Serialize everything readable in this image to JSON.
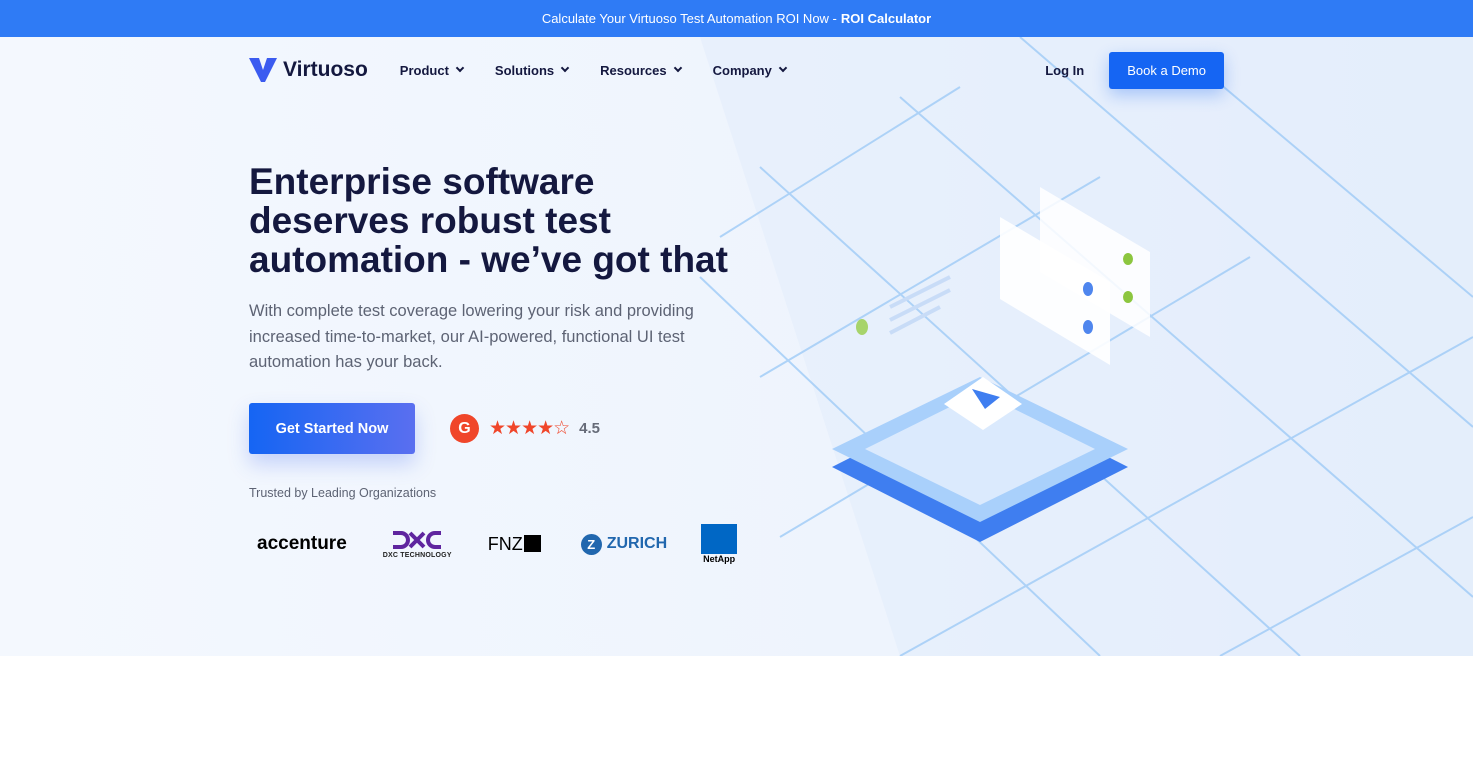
{
  "banner": {
    "text": "Calculate Your Virtuoso Test Automation ROI Now -",
    "link": "ROI Calculator"
  },
  "nav": {
    "logo": "Virtuoso",
    "items": [
      {
        "label": "Product"
      },
      {
        "label": "Solutions"
      },
      {
        "label": "Resources"
      },
      {
        "label": "Company"
      }
    ],
    "login": "Log In",
    "demo": "Book a Demo"
  },
  "hero": {
    "title": "Enterprise software deserves robust test automation - we’ve got that",
    "subtitle": "With complete test coverage lowering your risk and providing increased time-to-market, our AI-powered, functional UI test automation has your back.",
    "cta": "Get Started Now",
    "rating": {
      "logo": "G2",
      "stars": "★★★★☆",
      "value": "4.5",
      "fraction": 0.9
    },
    "trusted": "Trusted by Leading Organizations"
  },
  "logos": [
    "accenture",
    "DXC TECHNOLOGY",
    "FNZ",
    "ZURICH",
    "NetApp"
  ],
  "colors": {
    "accent": "#1565f3",
    "banner": "#2f7bf5",
    "heading": "#14183f",
    "g2": "#f0462a"
  }
}
